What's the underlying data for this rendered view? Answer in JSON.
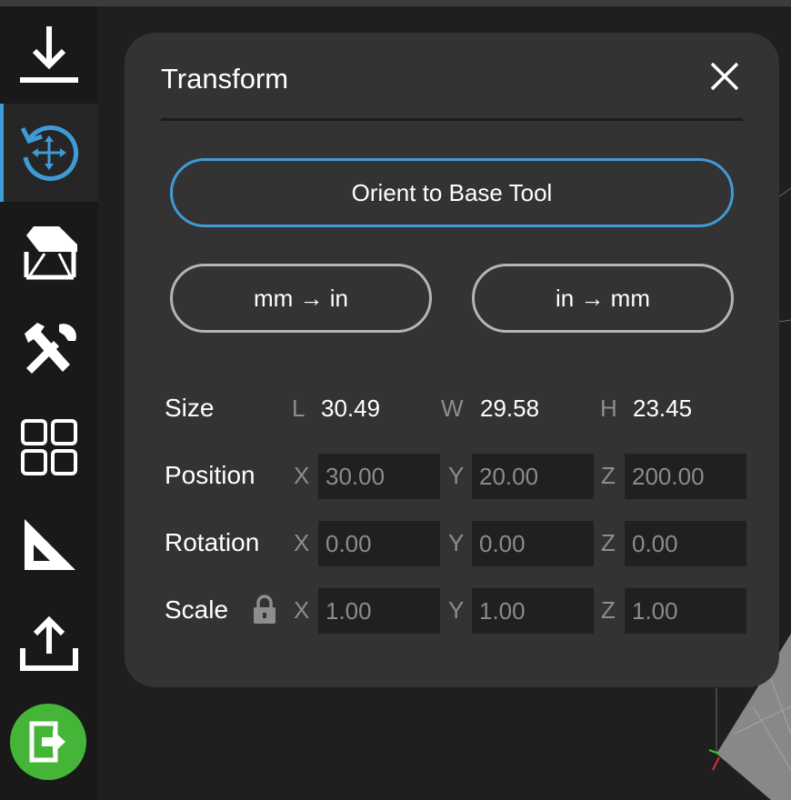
{
  "sidebar": {
    "items": [
      {
        "name": "download-icon"
      },
      {
        "name": "transform-icon",
        "active": true
      },
      {
        "name": "support-icon"
      },
      {
        "name": "tools-icon"
      },
      {
        "name": "arrange-icon"
      },
      {
        "name": "measure-icon"
      },
      {
        "name": "export-icon"
      },
      {
        "name": "exit-icon"
      }
    ],
    "accent_color": "#3e9bd8",
    "exit_color": "#45b537"
  },
  "panel": {
    "title": "Transform",
    "orient_button": "Orient to Base Tool",
    "mm_to_in_button": "mm → in",
    "in_to_mm_button": "in → mm",
    "size": {
      "label": "Size",
      "l_axis": "L",
      "l_value": "30.49",
      "w_axis": "W",
      "w_value": "29.58",
      "h_axis": "H",
      "h_value": "23.45"
    },
    "position": {
      "label": "Position",
      "x_axis": "X",
      "x_value": "30.00",
      "y_axis": "Y",
      "y_value": "20.00",
      "z_axis": "Z",
      "z_value": "200.00"
    },
    "rotation": {
      "label": "Rotation",
      "x_axis": "X",
      "x_value": "0.00",
      "y_axis": "Y",
      "y_value": "0.00",
      "z_axis": "Z",
      "z_value": "0.00"
    },
    "scale": {
      "label": "Scale",
      "x_axis": "X",
      "x_value": "1.00",
      "y_axis": "Y",
      "y_value": "1.00",
      "z_axis": "Z",
      "z_value": "1.00"
    }
  }
}
